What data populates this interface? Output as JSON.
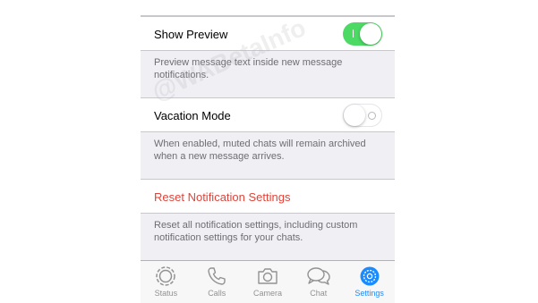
{
  "settings": {
    "show_preview": {
      "label": "Show Preview",
      "enabled": true,
      "footer": "Preview message text inside new message notifications."
    },
    "vacation_mode": {
      "label": "Vacation Mode",
      "enabled": false,
      "footer": "When enabled, muted chats will remain archived when a new message arrives."
    },
    "reset": {
      "label": "Reset Notification Settings",
      "color": "#e0443a",
      "footer": "Reset all notification settings, including custom notification settings for your chats."
    }
  },
  "tabbar": {
    "tabs": [
      {
        "label": "Status",
        "icon": "status-icon",
        "active": false
      },
      {
        "label": "Calls",
        "icon": "phone-icon",
        "active": false
      },
      {
        "label": "Camera",
        "icon": "camera-icon",
        "active": false
      },
      {
        "label": "Chat",
        "icon": "chat-bubbles-icon",
        "active": false
      },
      {
        "label": "Settings",
        "icon": "gear-icon",
        "active": true
      }
    ],
    "active_color": "#1a8cff",
    "inactive_color": "#929292"
  },
  "watermark": "@WABetaInfo",
  "colors": {
    "toggle_on": "#4cd964",
    "background": "#efeff4"
  }
}
